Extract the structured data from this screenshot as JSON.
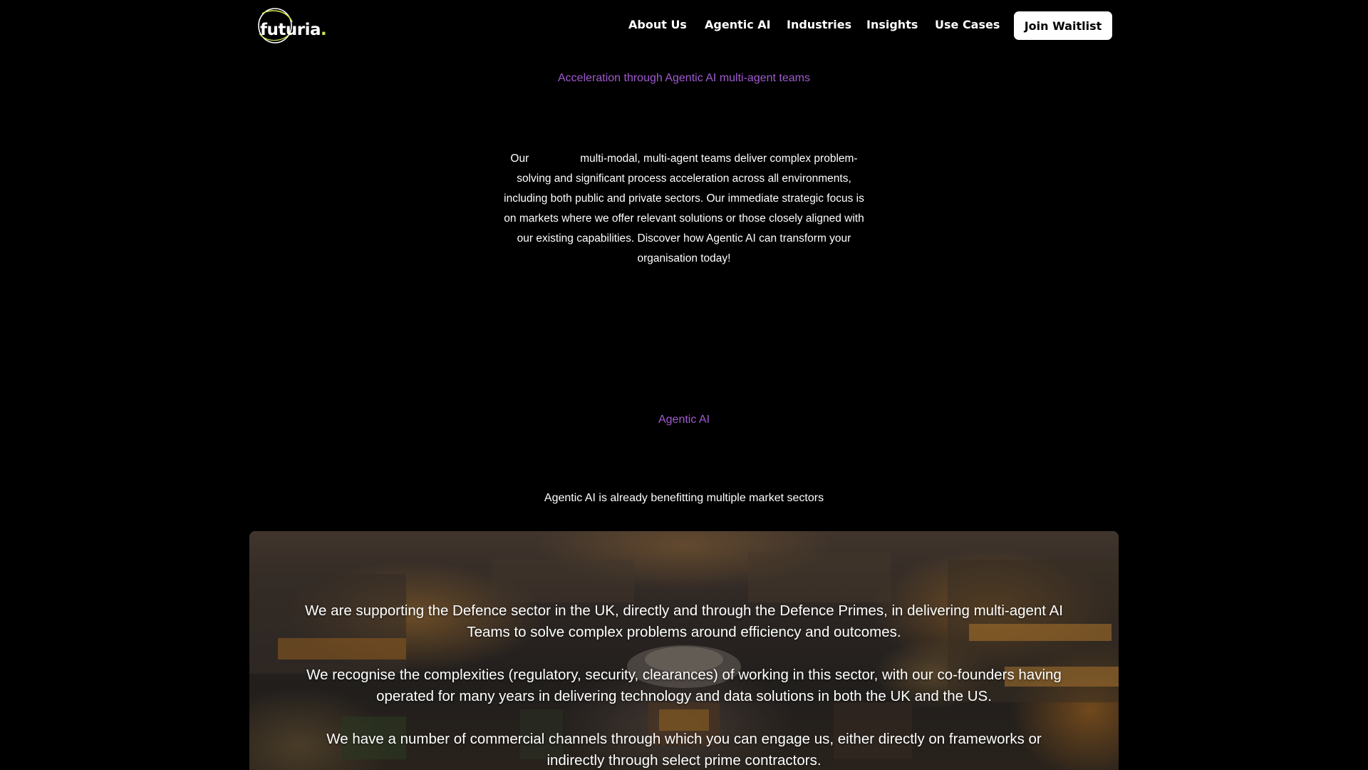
{
  "header": {
    "logo_text": "futuria",
    "logo_dot": ".",
    "nav": [
      {
        "label": "About Us"
      },
      {
        "label": "Agentic AI"
      },
      {
        "label": "Industries"
      },
      {
        "label": "Insights"
      },
      {
        "label": "Use Cases"
      }
    ],
    "cta_label": "Join Waitlist"
  },
  "hero": {
    "eyebrow": "Acceleration through Agentic AI multi-agent teams",
    "paragraph_start": "Our",
    "paragraph_rest": "multi-modal, multi-agent teams deliver complex problem-solving and significant process acceleration across all environments, including both public and private sectors. Our immediate strategic focus is on markets where we offer relevant solutions or those closely aligned with our existing capabilities. Discover how Agentic AI can transform your organisation today!"
  },
  "agentic_section": {
    "eyebrow": "Agentic AI",
    "subtitle": "Agentic AI is already benefitting multiple market sectors"
  },
  "defence_card": {
    "paragraphs": [
      "We are supporting the Defence sector in the UK, directly and through the Defence Primes, in delivering multi-agent AI Teams to solve complex problems around efficiency and outcomes.",
      "We recognise the complexities (regulatory, security, clearances) of working in this sector, with our co-founders having operated for many years in delivering technology and data solutions in both the UK and the US.",
      "We have a number of commercial channels through which you can engage us, either directly on frameworks or indirectly through select prime contractors."
    ]
  },
  "colors": {
    "background": "#000000",
    "accent_purple": "#a05ad0",
    "logo_accent": "#d6e84a",
    "button_bg": "#ffffff"
  }
}
